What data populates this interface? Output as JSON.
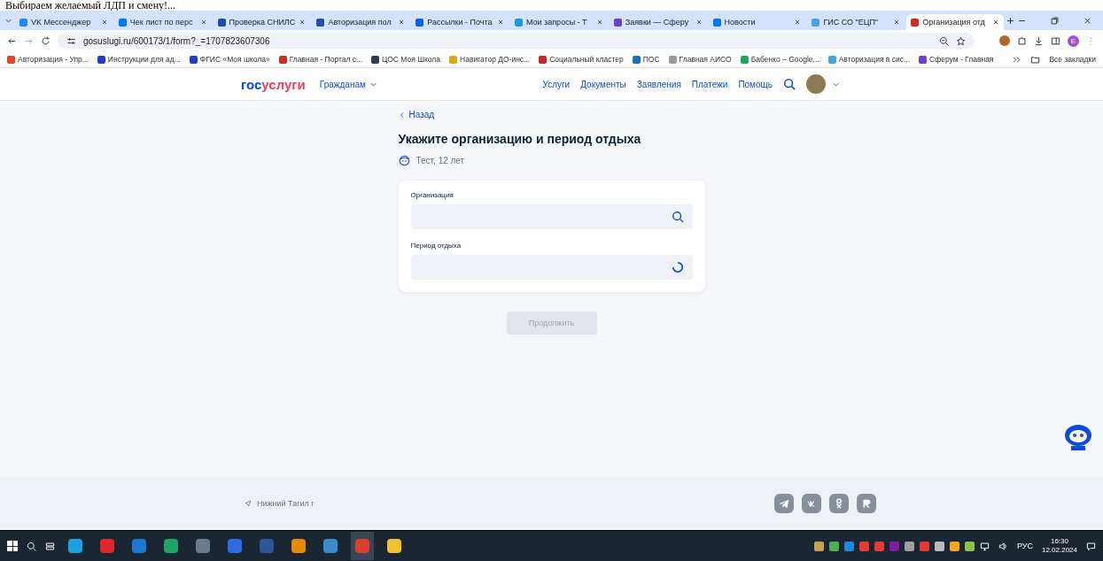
{
  "caption": "Выбираем желаемый ЛДП и смену!...",
  "tabs": [
    {
      "label": "VK Мессенджер",
      "selected": false,
      "color": "#2787f5"
    },
    {
      "label": "Чек лист по перс",
      "selected": false,
      "color": "#0077ff"
    },
    {
      "label": "Проверка СНИЛС",
      "selected": false,
      "color": "#1f4ea3"
    },
    {
      "label": "Авторизация пол",
      "selected": false,
      "color": "#1f4ea3"
    },
    {
      "label": "Рассылки - Почта",
      "selected": false,
      "color": "#005ff9"
    },
    {
      "label": "Мои запросы - Т",
      "selected": false,
      "color": "#1a9bd7"
    },
    {
      "label": "Заявки — Сферу",
      "selected": false,
      "color": "#6b3fd4"
    },
    {
      "label": "Новости",
      "selected": false,
      "color": "#0077ff"
    },
    {
      "label": "ГИС СО \"ЕЦП\"",
      "selected": false,
      "color": "#4aa3df"
    },
    {
      "label": "Организация отд",
      "selected": true,
      "color": "#d52b1e"
    }
  ],
  "address": "gosuslugi.ru/600173/1/form?_=1707823607306",
  "bookmarks": [
    {
      "label": "Авторизация - Упр...",
      "color": "#e0442d"
    },
    {
      "label": "Инструкции для ад...",
      "color": "#1d3fb8"
    },
    {
      "label": "ФГИС «Моя школа»",
      "color": "#1d3fb8"
    },
    {
      "label": "Главная - Портал с...",
      "color": "#d52b1e"
    },
    {
      "label": "ЦОС Моя Школа",
      "color": "#333d4a"
    },
    {
      "label": "Навигатор ДО-инс...",
      "color": "#e6a21a"
    },
    {
      "label": "Социальный кластер",
      "color": "#c62828"
    },
    {
      "label": "ПОС",
      "color": "#1e6fb8"
    },
    {
      "label": "Главная АИСО",
      "color": "#9a9a9a"
    },
    {
      "label": "Бабенко – Google...",
      "color": "#1fa463"
    },
    {
      "label": "Авторизация в сис...",
      "color": "#4aa3df"
    },
    {
      "label": "Сферум - Главная",
      "color": "#6b3fd4"
    }
  ],
  "all_bookmarks": "Все закладки",
  "profile_letter": "E",
  "site": {
    "logo_a": "гос",
    "logo_b": "услуги",
    "audience": "Гражданам",
    "nav": [
      "Услуги",
      "Документы",
      "Заявления",
      "Платежи",
      "Помощь"
    ]
  },
  "back": "Назад",
  "heading": "Укажите организацию и период отдыха",
  "child": "Тест, 12 лет",
  "fields": [
    {
      "label": "Организация",
      "kind": "search"
    },
    {
      "label": "Период отдыха",
      "kind": "loading"
    }
  ],
  "continue": {
    "label": "Продолжить",
    "disabled": true
  },
  "footer": {
    "city": "Нижний Тагил г"
  },
  "tray": {
    "lang": "РУС",
    "time": "16:30",
    "date": "12.02.2024"
  }
}
